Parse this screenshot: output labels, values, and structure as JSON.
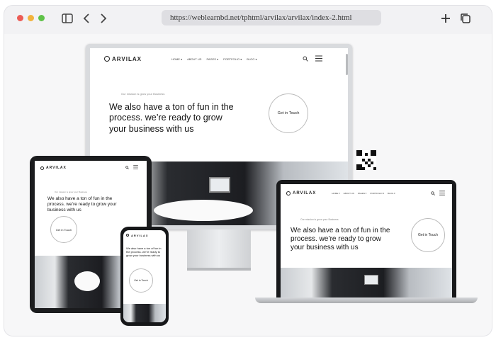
{
  "browser": {
    "url": "https://weblearnbd.net/tphtml/arvilax/arvilax/index-2.html",
    "traffic_lights": [
      "#ec5c55",
      "#f2b33d",
      "#5fc248"
    ]
  },
  "site": {
    "brand": "ARVILAX",
    "menu": [
      "HOME ▾",
      "ABOUT US",
      "PAGES ▾",
      "PORTFOLIO ▾",
      "BLOG ▾"
    ],
    "tagline": "Our mission is grow your Business",
    "headline": "We also have a ton of fun in the process. we’re ready to grow your business with us",
    "cta_label": "Get in Touch"
  }
}
